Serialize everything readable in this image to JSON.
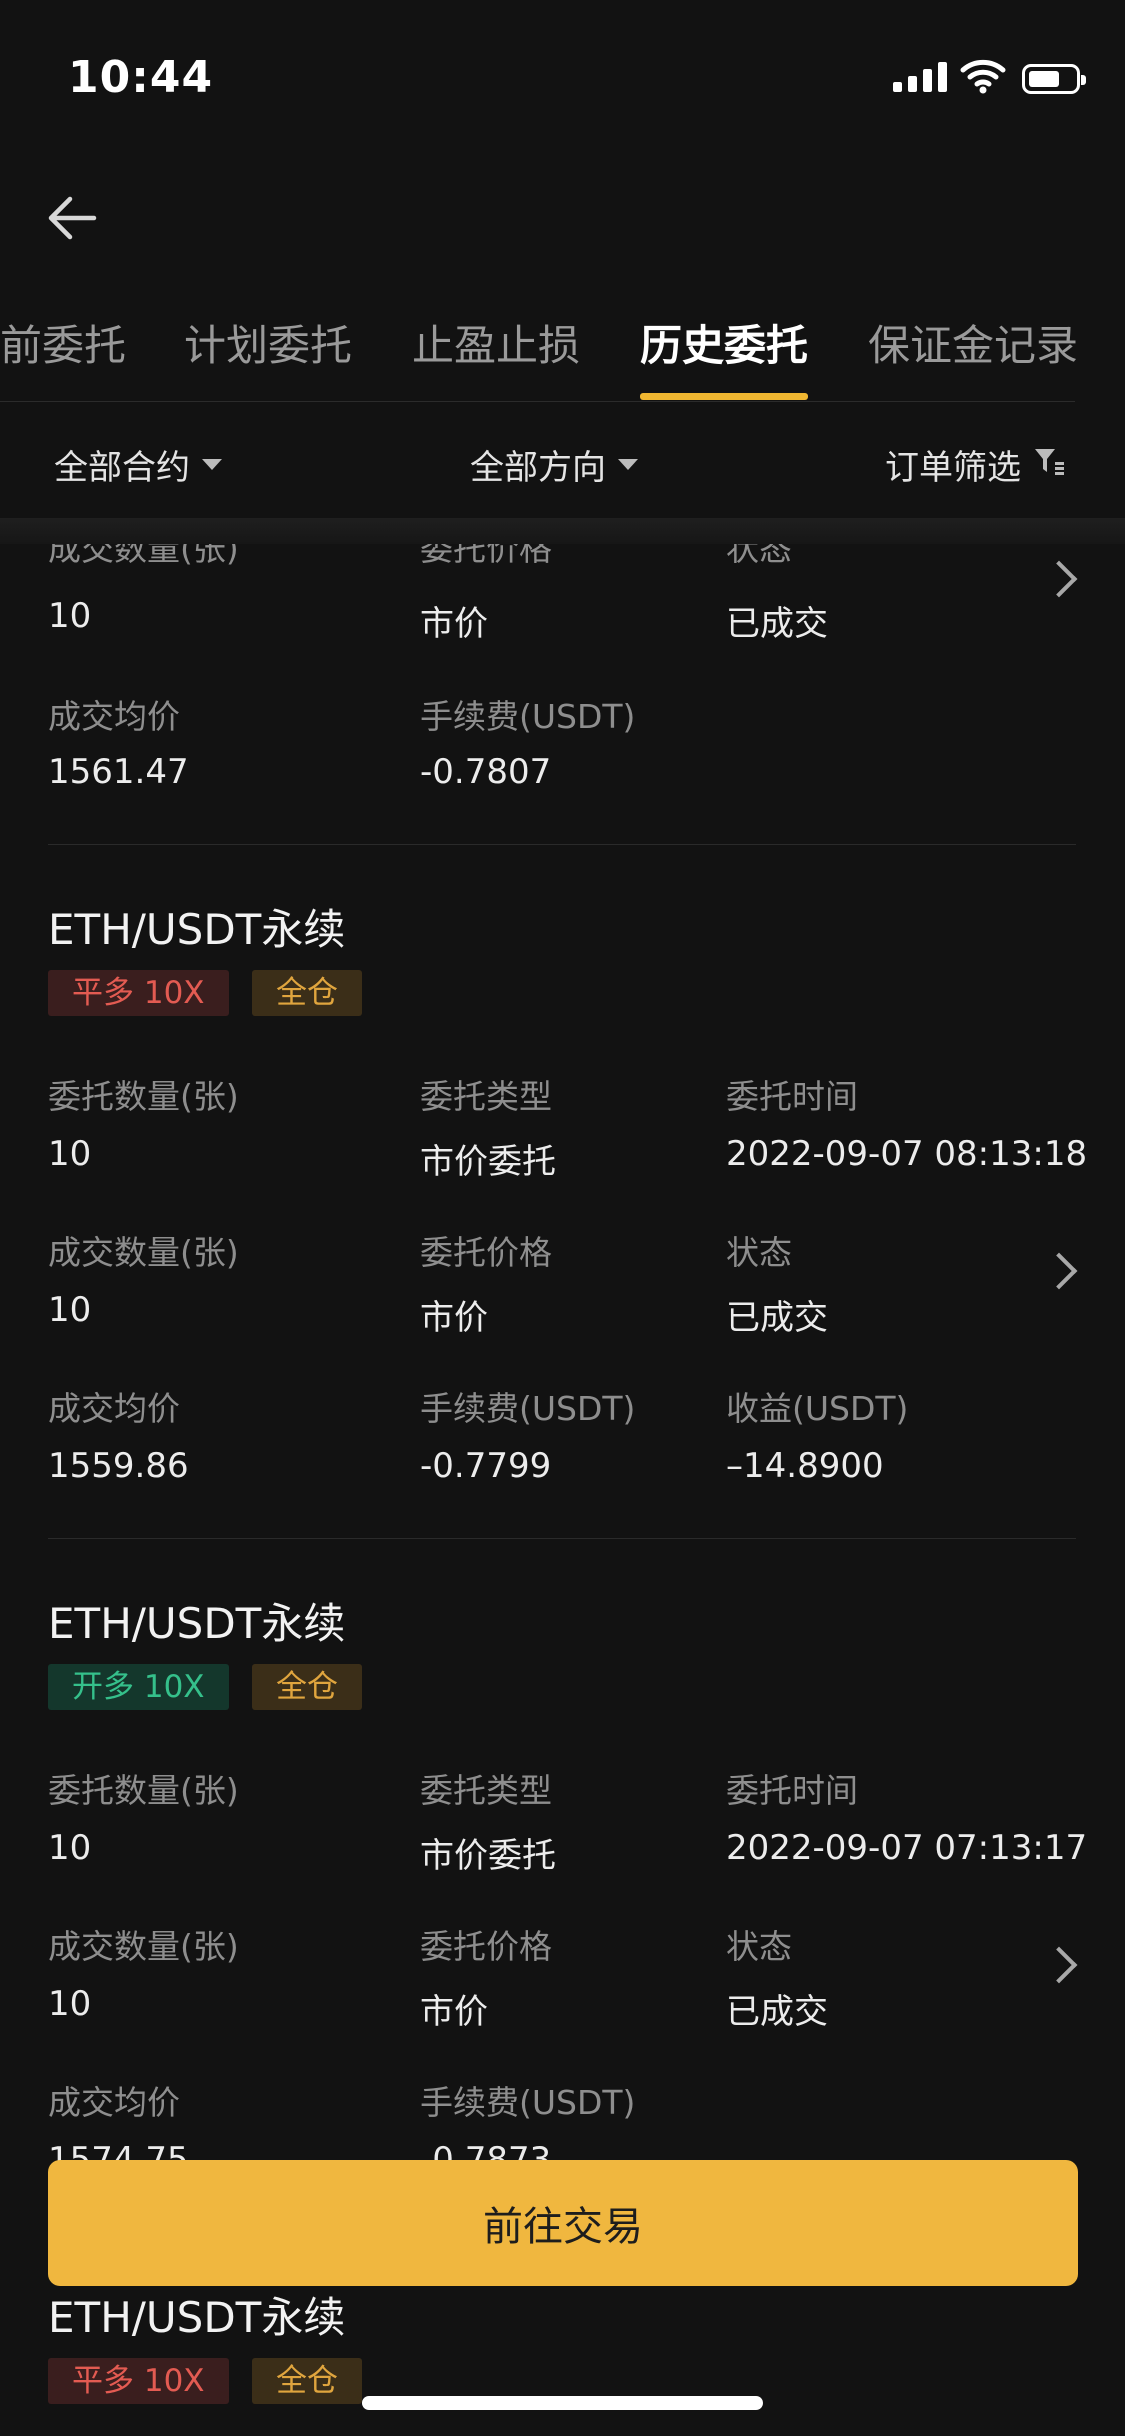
{
  "status_bar": {
    "time": "10:44"
  },
  "tabs": [
    {
      "label": "前委托"
    },
    {
      "label": "计划委托"
    },
    {
      "label": "止盈止损"
    },
    {
      "label": "历史委托"
    },
    {
      "label": "保证金记录"
    }
  ],
  "filters": {
    "contract": "全部合约",
    "direction": "全部方向",
    "order_filter": "订单筛选"
  },
  "labels": {
    "entrust_qty": "委托数量(张)",
    "entrust_type": "委托类型",
    "entrust_time": "委托时间",
    "deal_qty": "成交数量(张)",
    "entrust_price": "委托价格",
    "status": "状态",
    "avg_price": "成交均价",
    "fee": "手续费(USDT)",
    "profit": "收益(USDT)"
  },
  "partial_card": {
    "deal_qty": "10",
    "entrust_price": "市价",
    "status": "已成交",
    "avg_price": "1561.47",
    "fee": "-0.7807"
  },
  "orders": [
    {
      "pair": "ETH/USDT永续",
      "side": "平多 10X",
      "margin": "全仓",
      "entrust_qty": "10",
      "entrust_type": "市价委托",
      "entrust_time": "2022-09-07 08:13:18",
      "deal_qty": "10",
      "entrust_price": "市价",
      "status": "已成交",
      "avg_price": "1559.86",
      "fee": "-0.7799",
      "profit": "–14.8900"
    },
    {
      "pair": "ETH/USDT永续",
      "side": "开多 10X",
      "margin": "全仓",
      "entrust_qty": "10",
      "entrust_type": "市价委托",
      "entrust_time": "2022-09-07 07:13:17",
      "deal_qty": "10",
      "entrust_price": "市价",
      "status": "已成交",
      "avg_price": "1574.75",
      "fee": "-0.7873"
    },
    {
      "pair": "ETH/USDT永续",
      "side": "平多 10X",
      "margin": "全仓"
    }
  ],
  "cta": {
    "label": "前往交易"
  },
  "colors": {
    "background": "#121212",
    "accent": "#f0b73f",
    "tag_red": "#e35b52",
    "tag_green": "#35c08b",
    "tag_gold": "#e0a53e"
  },
  "icons": [
    "back-arrow-icon",
    "caret-down-icon",
    "filter-icon",
    "chevron-right-icon",
    "signal-icon",
    "wifi-icon",
    "battery-icon"
  ]
}
